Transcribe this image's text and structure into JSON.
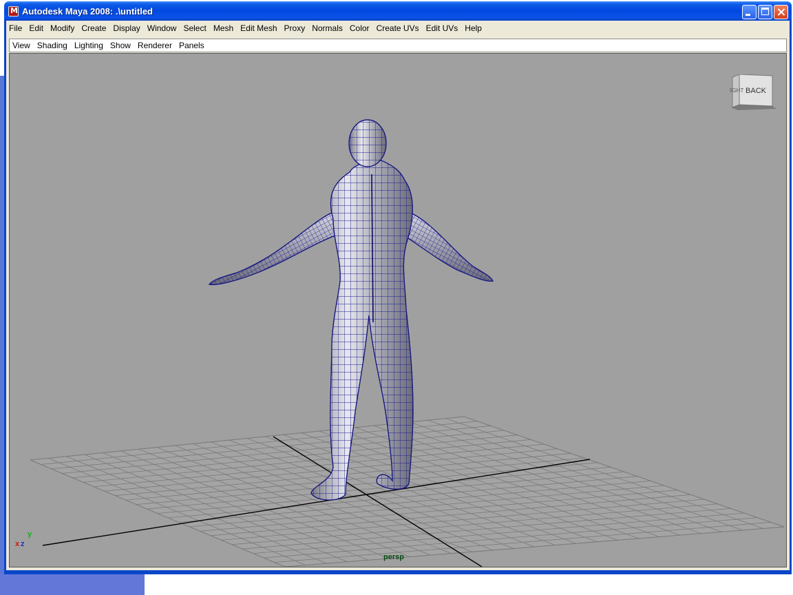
{
  "window": {
    "title": "Autodesk Maya 2008: .\\untitled",
    "app_icon": "maya-app-icon",
    "controls": [
      "minimize-icon",
      "maximize-icon",
      "close-icon"
    ]
  },
  "menubar": {
    "items": [
      "File",
      "Edit",
      "Modify",
      "Create",
      "Display",
      "Window",
      "Select",
      "Mesh",
      "Edit Mesh",
      "Proxy",
      "Normals",
      "Color",
      "Create UVs",
      "Edit UVs",
      "Help"
    ]
  },
  "panel_menubar": {
    "items": [
      "View",
      "Shading",
      "Lighting",
      "Show",
      "Renderer",
      "Panels"
    ]
  },
  "viewport": {
    "camera": "persp",
    "view_cube": {
      "left_face": "RGHT",
      "front_face": "BACK"
    },
    "axes": {
      "x": "x",
      "y": "y",
      "z": "z"
    },
    "background_color": "#a0a0a0",
    "wireframe_color": "#1a1a8c"
  }
}
